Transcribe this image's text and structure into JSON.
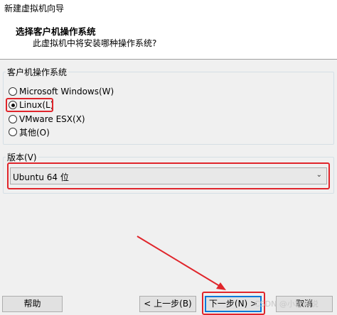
{
  "window": {
    "title": "新建虚拟机向导"
  },
  "header": {
    "title": "选择客户机操作系统",
    "subtitle": "此虚拟机中将安装哪种操作系统?"
  },
  "guest_os_group": {
    "label": "客户机操作系统",
    "options": [
      {
        "label": "Microsoft Windows(W)",
        "checked": false
      },
      {
        "label": "Linux(L)",
        "checked": true
      },
      {
        "label": "VMware ESX(X)",
        "checked": false
      },
      {
        "label": "其他(O)",
        "checked": false
      }
    ]
  },
  "version_group": {
    "label": "版本(V)",
    "selected": "Ubuntu 64 位"
  },
  "buttons": {
    "help": "帮助",
    "back": "< 上一步(B)",
    "next": "下一步(N) >",
    "cancel": "取消"
  },
  "watermark": "CSDN @小智解说",
  "colors": {
    "highlight": "#e0252b",
    "default_button_border": "#0078d7"
  }
}
